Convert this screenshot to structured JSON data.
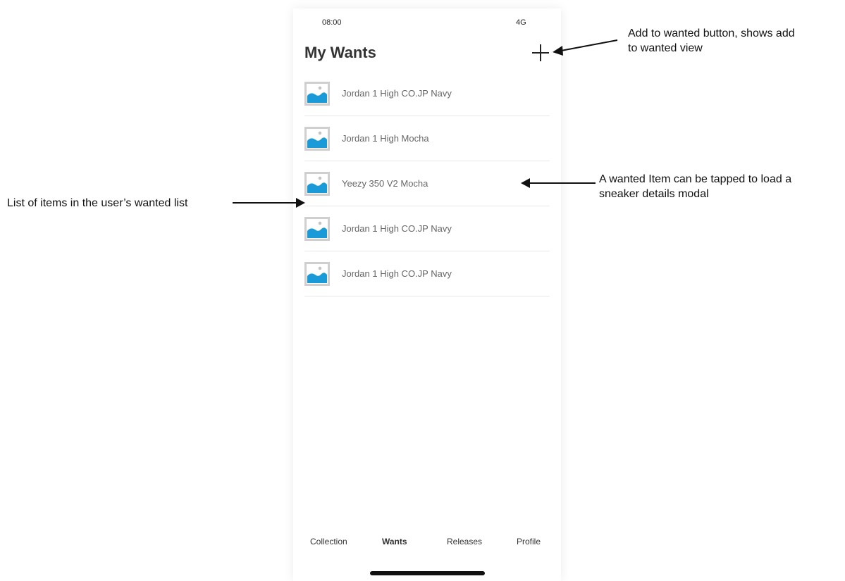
{
  "status_bar": {
    "time": "08:00",
    "network": "4G"
  },
  "header": {
    "title": "My Wants",
    "add_button_icon": "plus-icon"
  },
  "wants": [
    {
      "name": "Jordan 1 High CO.JP Navy",
      "thumbnail": "image-placeholder-icon"
    },
    {
      "name": "Jordan 1 High Mocha",
      "thumbnail": "image-placeholder-icon"
    },
    {
      "name": "Yeezy 350 V2 Mocha",
      "thumbnail": "image-placeholder-icon"
    },
    {
      "name": "Jordan 1 High CO.JP Navy",
      "thumbnail": "image-placeholder-icon"
    },
    {
      "name": "Jordan 1 High CO.JP Navy",
      "thumbnail": "image-placeholder-icon"
    }
  ],
  "tabs": [
    {
      "label": "Collection",
      "active": false
    },
    {
      "label": "Wants",
      "active": true
    },
    {
      "label": "Releases",
      "active": false
    },
    {
      "label": "Profile",
      "active": false
    }
  ],
  "annotations": {
    "add_button_line1": "Add to wanted button, shows add",
    "add_button_line2": "to wanted view",
    "item_tap_line1": "A wanted Item can be tapped to load a",
    "item_tap_line2": "sneaker details modal",
    "list_note": "List of items in the user’s wanted list"
  },
  "colors": {
    "thumbnail_blue": "#1a9ad6",
    "thumbnail_frame": "#cfcfcf"
  }
}
